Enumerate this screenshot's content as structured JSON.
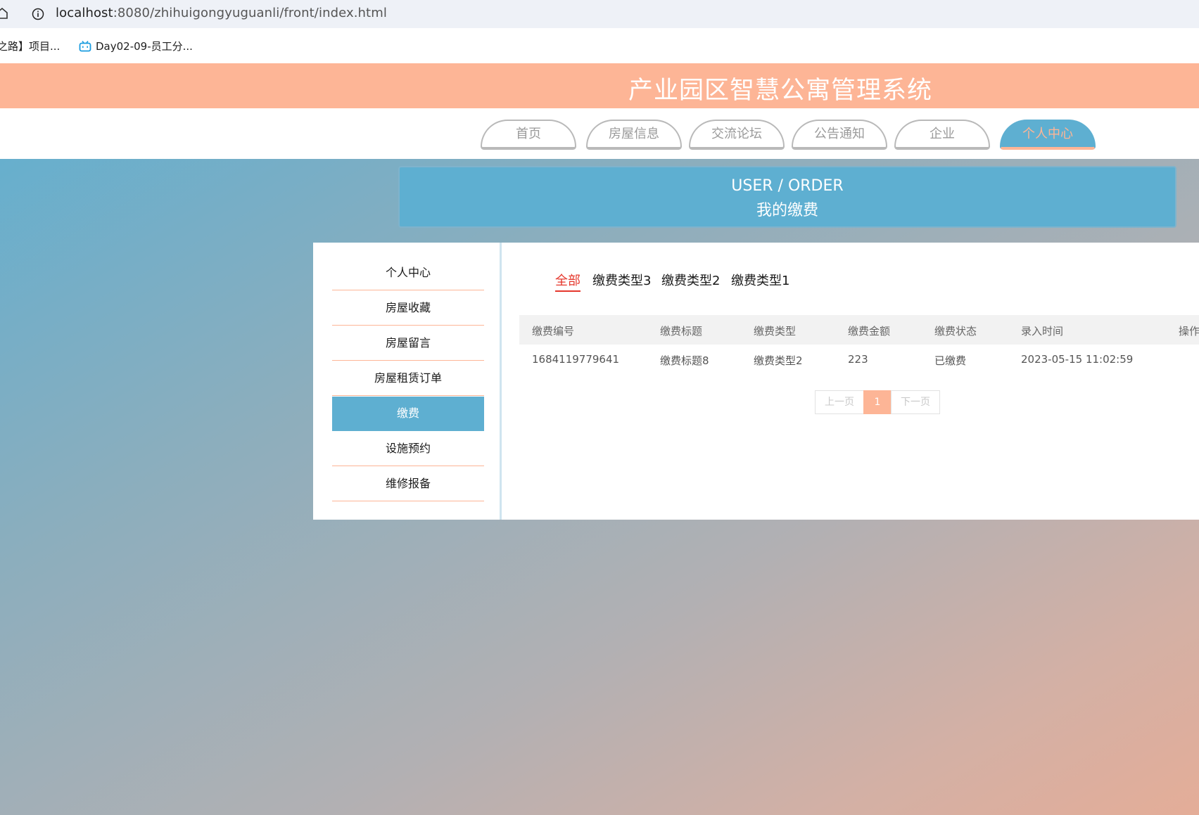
{
  "browser": {
    "url_host": "localhost",
    "url_rest": ":8080/zhihuigongyuguanli/front/index.html",
    "bookmarks": [
      "之路】项目...",
      "Day02-09-员工分..."
    ]
  },
  "site": {
    "title": "产业园区智慧公寓管理系统",
    "nav": [
      "首页",
      "房屋信息",
      "交流论坛",
      "公告通知",
      "企业",
      "个人中心"
    ],
    "active_nav": "个人中心",
    "banner": {
      "en": "USER / ORDER",
      "cn": "我的缴费"
    }
  },
  "sidebar": {
    "items": [
      "个人中心",
      "房屋收藏",
      "房屋留言",
      "房屋租赁订单",
      "缴费",
      "设施预约",
      "维修报备"
    ],
    "active": "缴费"
  },
  "filters": {
    "items": [
      "全部",
      "缴费类型3",
      "缴费类型2",
      "缴费类型1"
    ],
    "active": "全部"
  },
  "table": {
    "headers": [
      "缴费编号",
      "缴费标题",
      "缴费类型",
      "缴费金额",
      "缴费状态",
      "录入时间",
      "操作"
    ],
    "rows": [
      [
        "1684119779641",
        "缴费标题8",
        "缴费类型2",
        "223",
        "已缴费",
        "2023-05-15 11:02:59"
      ]
    ]
  },
  "pagination": {
    "prev": "上一页",
    "current": "1",
    "next": "下一页"
  },
  "colors": {
    "accent_blue": "#5eafd1",
    "accent_peach": "#fdb596",
    "active_filter": "#e5372c"
  },
  "icons": {
    "home": "home-icon",
    "info": "info-icon",
    "bookmark": "bilibili-tv-icon"
  }
}
